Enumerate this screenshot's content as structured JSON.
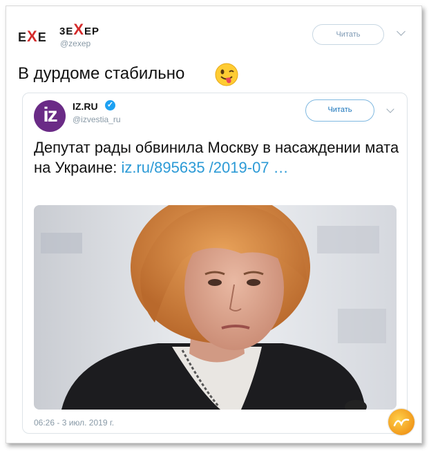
{
  "outer_tweet": {
    "logo_left": "E",
    "logo_x": "X",
    "logo_right": "E",
    "author_name_left": "3E",
    "author_name_x": "X",
    "author_name_right": "EP",
    "author_handle": "@zexep",
    "follow_label": "Читать",
    "text": "В дурдоме стабильно",
    "emoji": "winking-face-with-tongue"
  },
  "quoted_tweet": {
    "avatar_text": "iz",
    "author_name": "IZ.RU",
    "verified_glyph": "✓",
    "author_handle": "@izvestia_ru",
    "follow_label": "Читать",
    "headline": "Депутат рады обвинила Москву в насаждении мата на Украине: ",
    "link_text": "iz.ru/895635 /2019-07  …",
    "timestamp": "06:26 - 3 июл. 2019 г."
  },
  "colors": {
    "accent_blue": "#1da1f2",
    "link_blue": "#2b9ad6",
    "iz_purple": "#6a2b86",
    "logo_red": "#d42b2b"
  }
}
